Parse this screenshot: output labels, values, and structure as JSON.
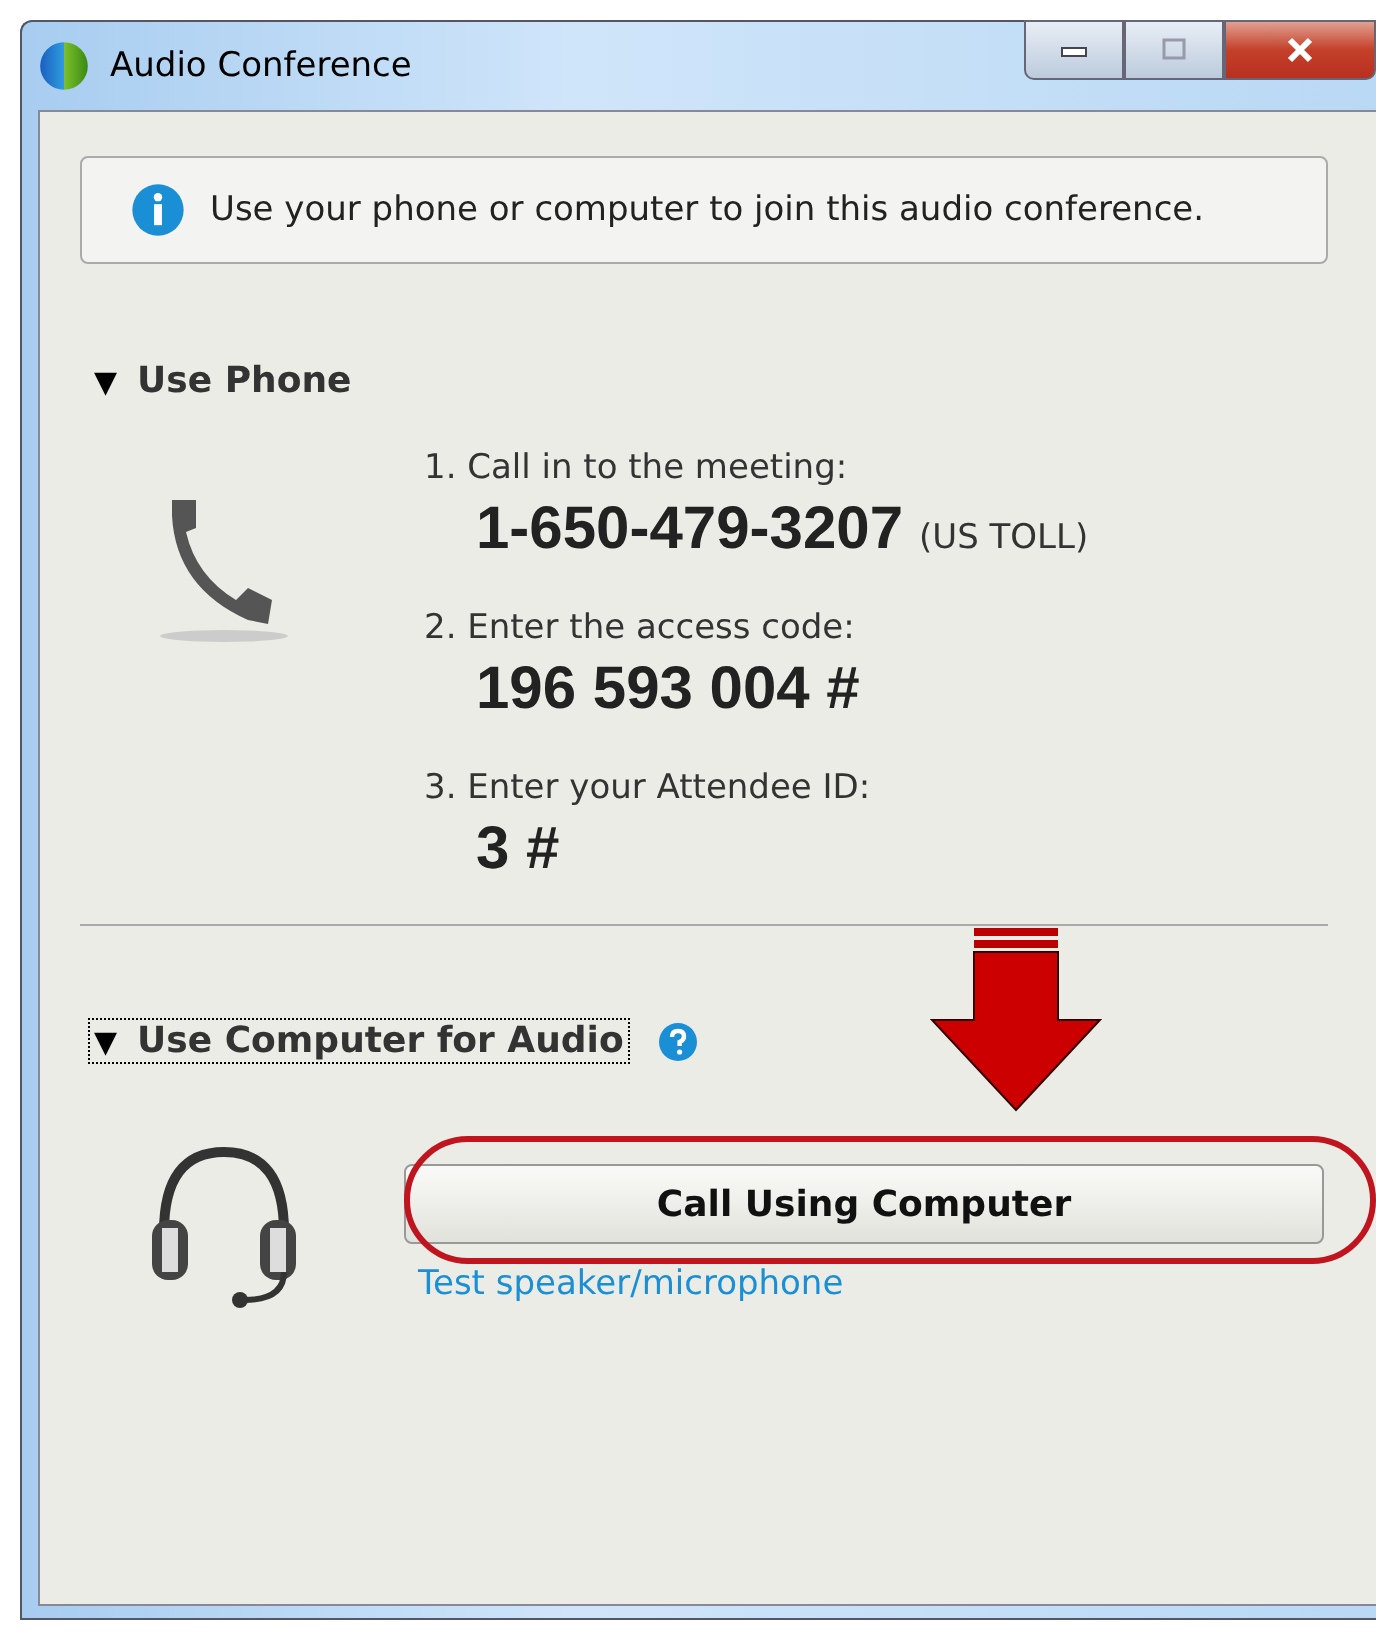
{
  "window": {
    "title": "Audio Conference"
  },
  "info": {
    "text": "Use your phone or computer to join this audio conference."
  },
  "phone_section": {
    "toggle": "▼",
    "title": "Use Phone",
    "focused": false,
    "steps": [
      {
        "label": "1. Call in to the meeting:",
        "value": "1-650-479-3207",
        "note": "(US TOLL)"
      },
      {
        "label": "2. Enter the access code:",
        "value": "196 593 004 #"
      },
      {
        "label": "3. Enter your Attendee ID:",
        "value": "3 #"
      }
    ]
  },
  "computer_section": {
    "toggle": "▼",
    "title": "Use Computer for Audio",
    "focused": true,
    "button": "Call Using Computer",
    "link": "Test speaker/microphone"
  }
}
